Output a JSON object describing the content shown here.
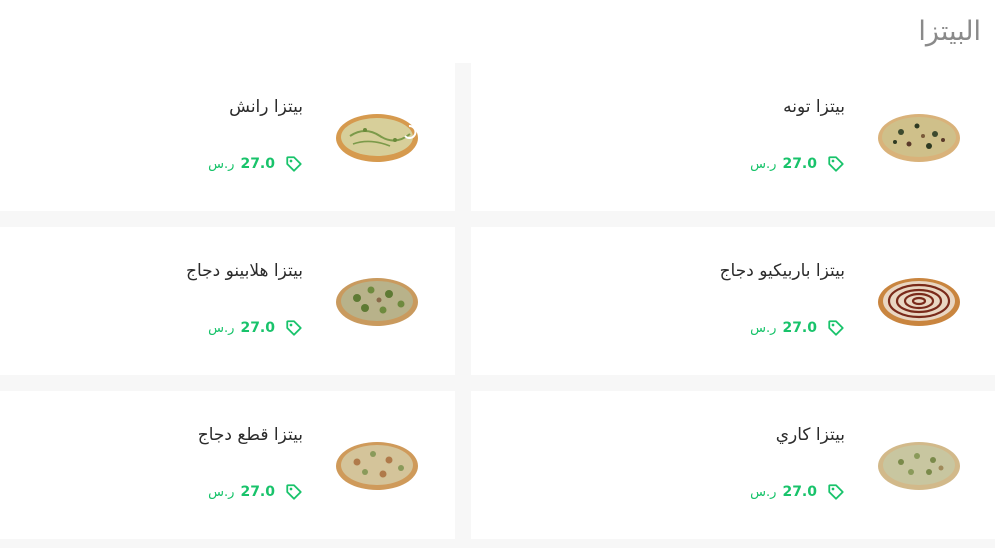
{
  "section": {
    "title": "البيتزا"
  },
  "colors": {
    "accent": "#19c36b",
    "title": "#8a8a8a"
  },
  "items": [
    {
      "name": "بيتزا تونه",
      "price": "27.0",
      "currency": "ر.س",
      "image_icon": "pizza-tuna-image"
    },
    {
      "name": "بيتزا رانش",
      "price": "27.0",
      "currency": "ر.س",
      "image_icon": "pizza-ranch-image"
    },
    {
      "name": "بيتزا باربيكيو دجاج",
      "price": "27.0",
      "currency": "ر.س",
      "image_icon": "pizza-bbq-chicken-image"
    },
    {
      "name": "بيتزا هلابينو دجاج",
      "price": "27.0",
      "currency": "ر.س",
      "image_icon": "pizza-jalapeno-chicken-image"
    },
    {
      "name": "بيتزا كاري",
      "price": "27.0",
      "currency": "ر.س",
      "image_icon": "pizza-curry-image"
    },
    {
      "name": "بيتزا قطع دجاج",
      "price": "27.0",
      "currency": "ر.س",
      "image_icon": "pizza-chicken-pieces-image"
    }
  ]
}
